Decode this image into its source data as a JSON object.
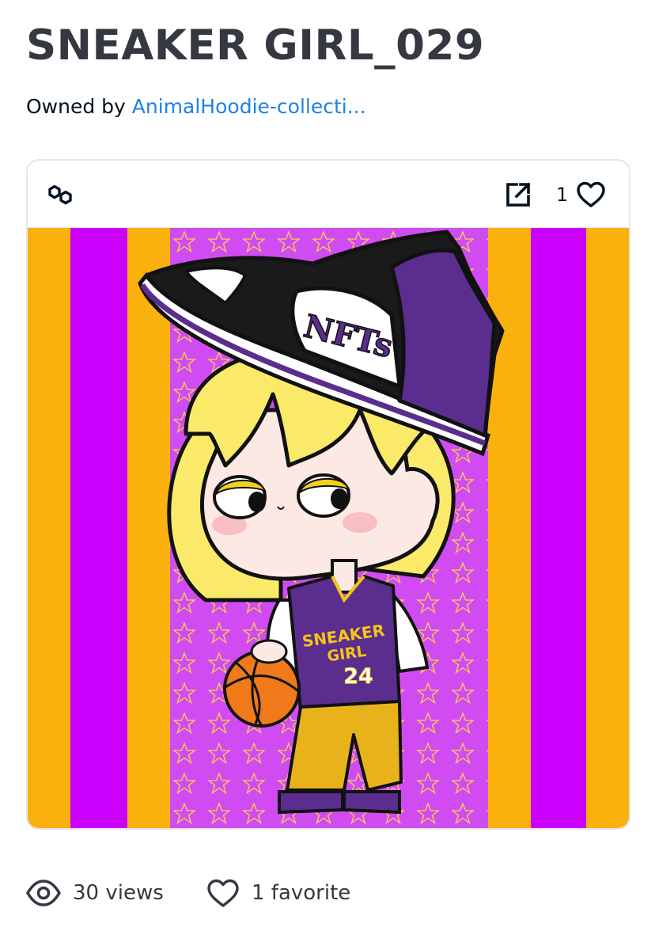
{
  "asset": {
    "title": "SNEAKER GIRL_029",
    "owned_by_label": "Owned by",
    "owner_name": "AnimalHoodie-collecti..."
  },
  "card": {
    "chain_icon": "polygon-icon",
    "external_link_icon": "external-link-icon",
    "favorite_count": "1",
    "favorite_icon": "heart-icon"
  },
  "artwork": {
    "jersey_text_line1": "SNEAKER",
    "jersey_text_line2": "GIRL",
    "jersey_number": "24",
    "shoe_logo_text": "NFTs",
    "colors": {
      "stripe_orange": "#fbb10d",
      "stripe_magenta": "#cc00ff",
      "center_purple": "#d04cf2",
      "jersey_purple": "#5a2d8f",
      "hair_yellow": "#fbea6a"
    }
  },
  "stats": {
    "views_icon": "eye-icon",
    "views_label": "30 views",
    "favorites_icon": "heart-outline-icon",
    "favorites_label": "1 favorite"
  }
}
